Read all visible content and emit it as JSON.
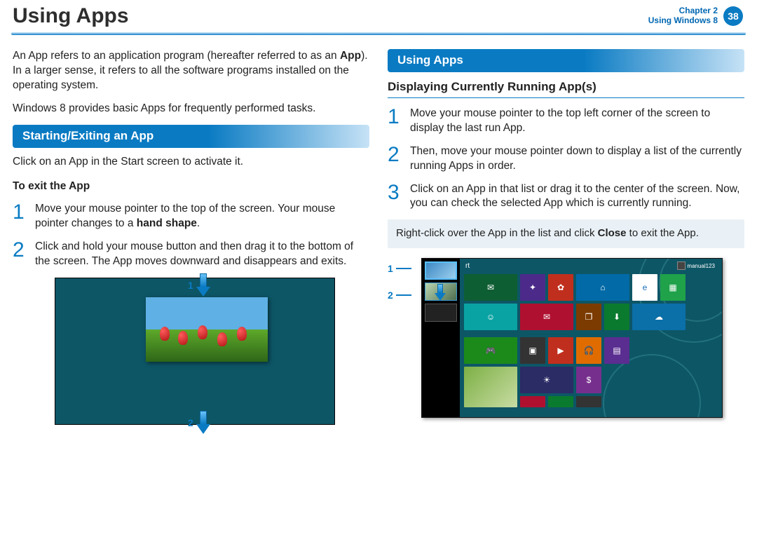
{
  "header": {
    "title": "Using Apps",
    "chapter_line": "Chapter 2",
    "section_line": "Using Windows 8",
    "page_number": "38"
  },
  "left": {
    "intro1_a": "An App refers to an application program (hereafter referred to as an ",
    "intro1_bold": "App",
    "intro1_b": "). In a larger sense, it refers to all the software programs installed on the operating system.",
    "intro2": "Windows 8 provides basic Apps for frequently performed tasks.",
    "section_bar": "Starting/Exiting an App",
    "start_text": "Click on an App in the Start screen to activate it.",
    "exit_heading": "To exit the App",
    "step1_a": "Move your mouse pointer to the top of the screen. Your mouse pointer changes to a ",
    "step1_bold": "hand shape",
    "step1_b": ".",
    "step2": "Click and hold your mouse button and then drag it to the bottom of the screen. The App moves downward and disappears and exits.",
    "callout1": "1",
    "callout2": "2"
  },
  "right": {
    "section_bar": "Using Apps",
    "sub_heading": "Displaying Currently Running App(s)",
    "step1": "Move your mouse pointer to the top left corner of the screen to display the last run App.",
    "step2": "Then, move your mouse pointer down to display a list of the currently running Apps in order.",
    "step3": "Click on an App in that list or drag it to the center of the screen. Now, you can check the selected App which is currently running.",
    "note_a": "Right-click over the App in the list and click ",
    "note_bold": "Close",
    "note_b": " to exit the App.",
    "callout1": "1",
    "callout2": "2",
    "fig2": {
      "start": "rt",
      "user": "manual123"
    }
  },
  "nums": {
    "n1": "1",
    "n2": "2",
    "n3": "3"
  }
}
